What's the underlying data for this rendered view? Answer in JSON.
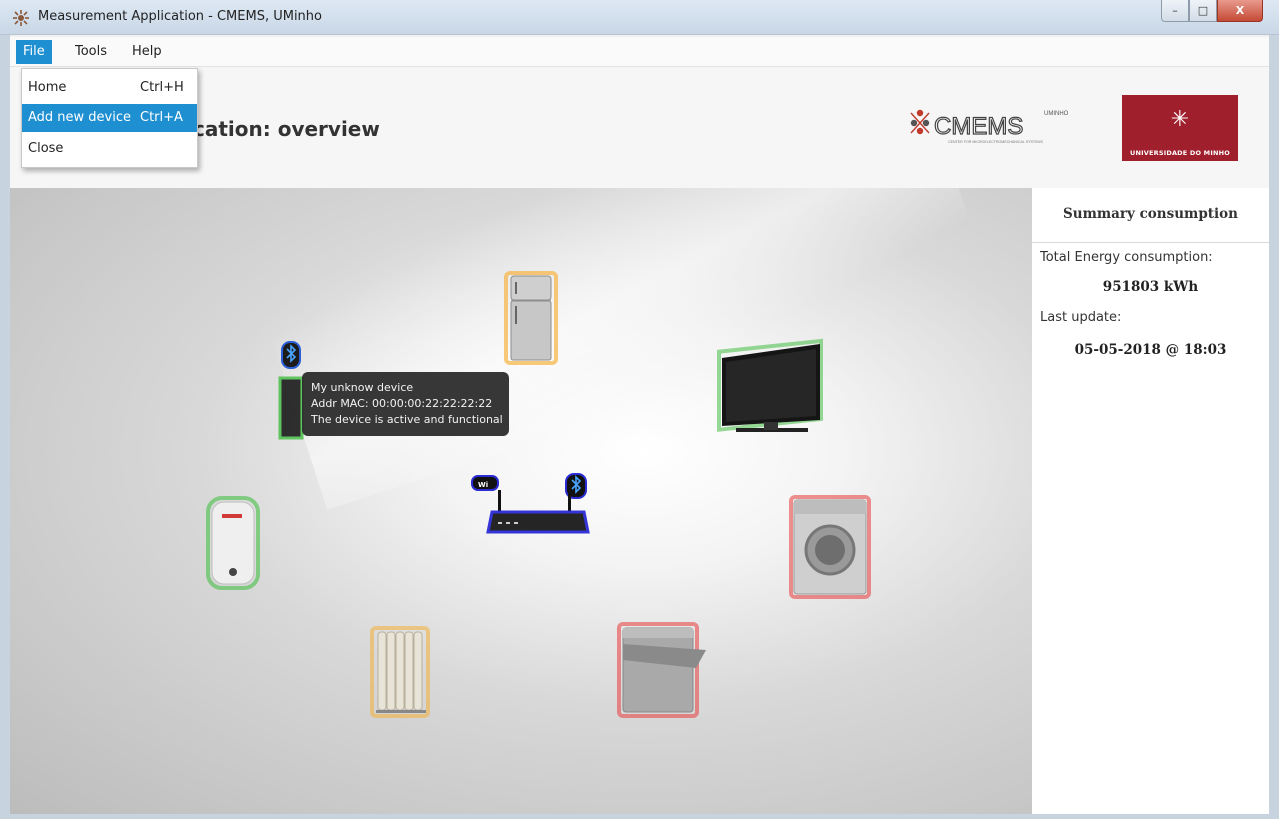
{
  "window": {
    "title": "Measurement Application - CMEMS, UMinho",
    "controls": {
      "minimize": "–",
      "maximize": "□",
      "close": "X"
    }
  },
  "menubar": {
    "items": [
      {
        "label": "File",
        "active": true
      },
      {
        "label": "Tools",
        "active": false
      },
      {
        "label": "Help",
        "active": false
      }
    ]
  },
  "file_menu": {
    "items": [
      {
        "label": "Home",
        "shortcut": "Ctrl+H",
        "highlighted": false
      },
      {
        "label": "Add new device",
        "shortcut": "Ctrl+A",
        "highlighted": true
      },
      {
        "label": "Close",
        "shortcut": "",
        "highlighted": false
      }
    ]
  },
  "header": {
    "title_visible": "cation: overview",
    "logos": {
      "cmems": {
        "text": "CMEMS",
        "sub": "UMINHO",
        "tagline": "CENTER FOR MICROELECTROMECHANICAL SYSTEMS"
      },
      "uminho": {
        "symbol": "✳",
        "text": "UNIVERSIDADE DO MINHO"
      }
    }
  },
  "canvas": {
    "devices": [
      {
        "name": "fridge",
        "status_color": "#f5b342"
      },
      {
        "name": "television",
        "status_color": "#52c152"
      },
      {
        "name": "bluetooth-device",
        "status_color": "#52c152"
      },
      {
        "name": "router",
        "status_color": "#2b2bd6",
        "badges": [
          "wifi",
          "bluetooth"
        ]
      },
      {
        "name": "water-heater",
        "status_color": "#52c152"
      },
      {
        "name": "washing-machine",
        "status_color": "#e84a4a"
      },
      {
        "name": "oil-heater",
        "status_color": "#f5b342"
      },
      {
        "name": "dishwasher",
        "status_color": "#e84a4a"
      }
    ],
    "tooltip": {
      "line1": "My unknow device",
      "line2": "Addr MAC: 00:00:00:22:22:22:22",
      "line3": "The device is active and functional"
    }
  },
  "summary": {
    "title": "Summary consumption",
    "energy_label": "Total Energy consumption:",
    "energy_value": "951803 kWh",
    "update_label": "Last update:",
    "update_value": "05-05-2018 @ 18:03"
  }
}
